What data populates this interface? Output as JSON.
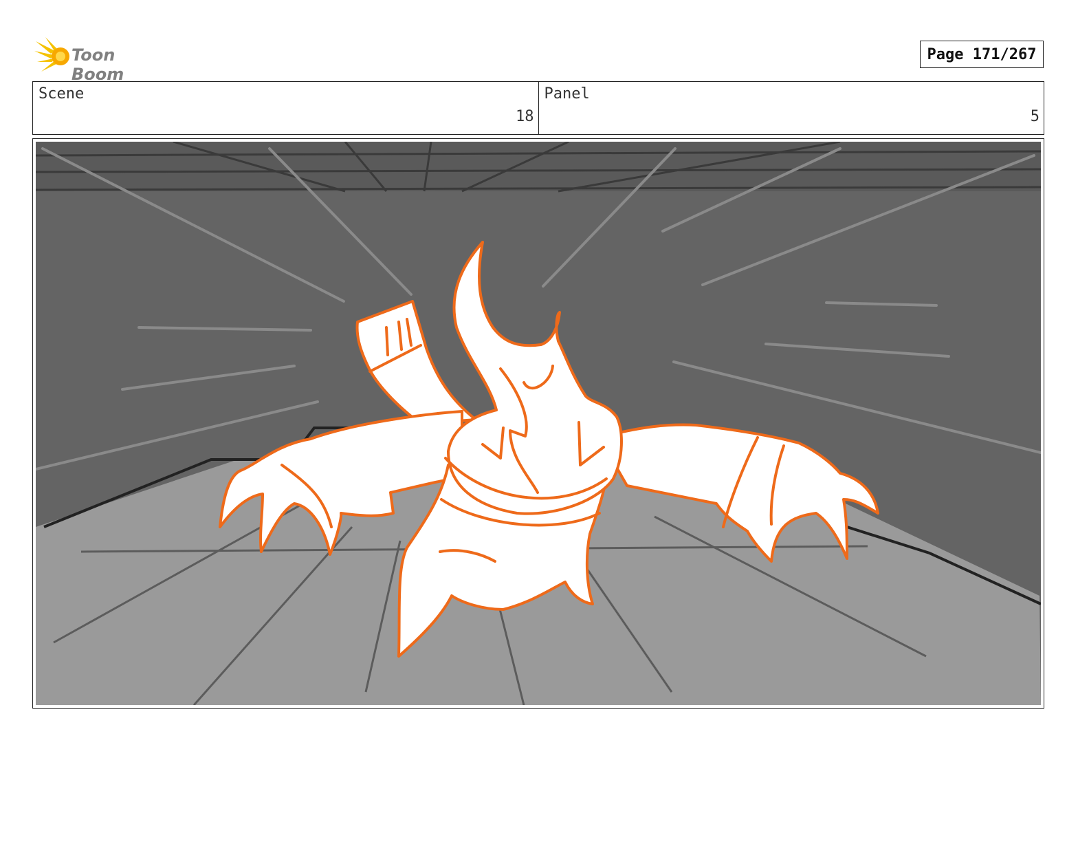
{
  "header": {
    "logo_text": "Toon Boom",
    "page_label": "Page 171/267"
  },
  "info": {
    "scene_label": "Scene",
    "scene_value": "18",
    "panel_label": "Panel",
    "panel_value": "5"
  },
  "colors": {
    "character_outline": "#ee6a1a",
    "wall": "#646464",
    "floor": "#999999"
  }
}
